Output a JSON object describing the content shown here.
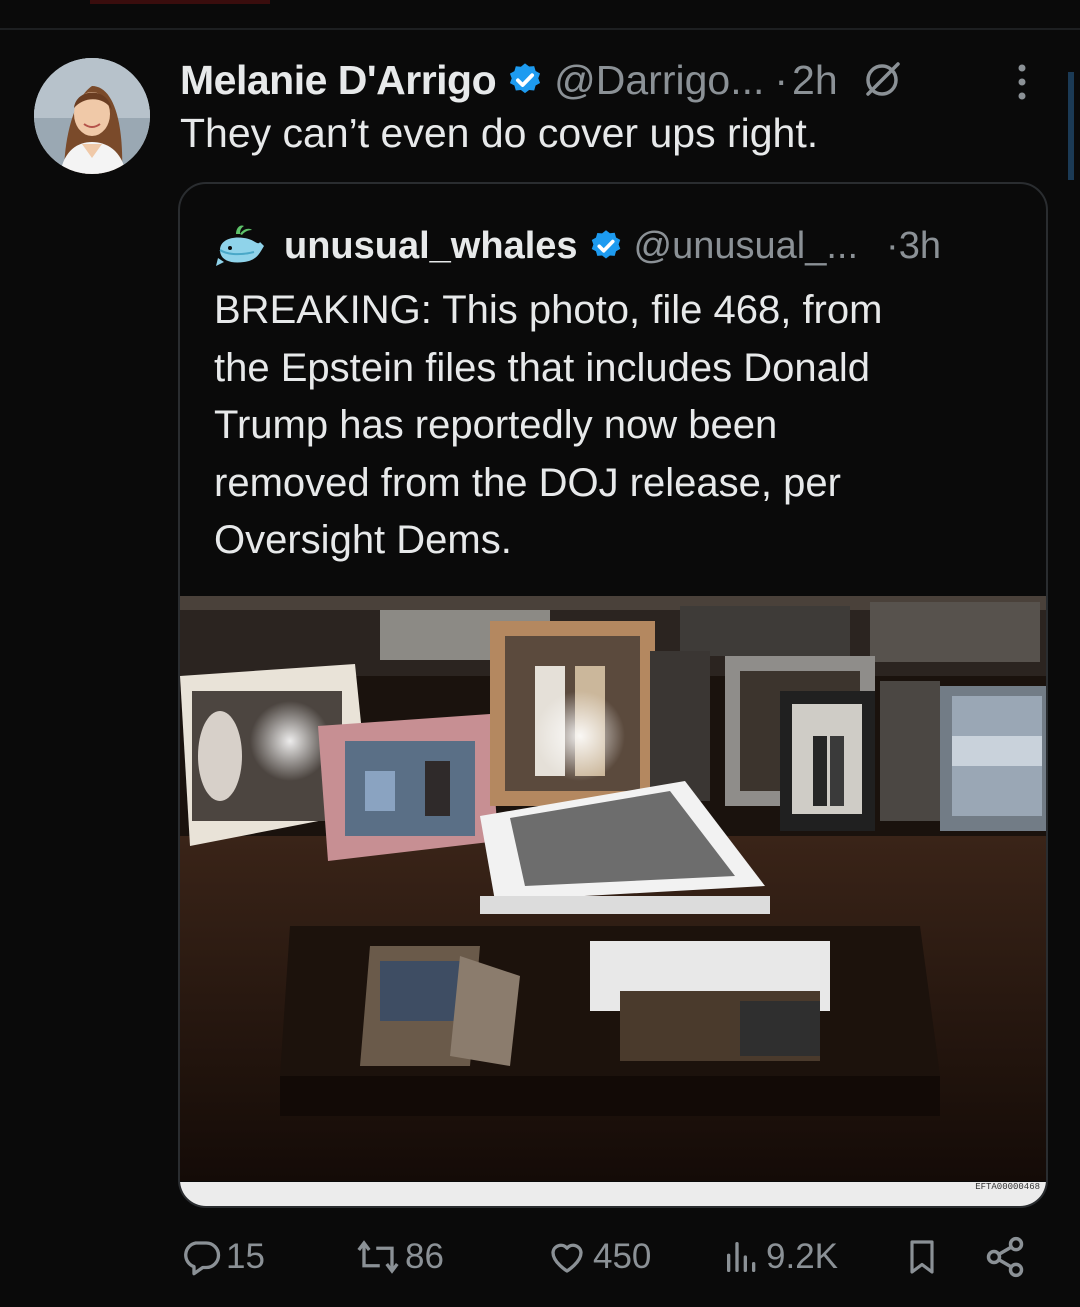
{
  "post": {
    "author_name": "Melanie D'Arrigo",
    "handle": "@Darrigo...",
    "separator": "·",
    "time": "2h",
    "text": "They can’t even do cover ups right."
  },
  "quoted_post": {
    "author_name": "unusual_whales",
    "handle": "@unusual_...",
    "separator": "·",
    "time": "3h",
    "text_lines": [
      "BREAKING: This photo, file 468, from",
      "the Epstein files that includes Donald",
      "Trump has reportedly now been",
      "removed from the DOJ release, per",
      "Oversight Dems."
    ],
    "photo_tag": "EFTA00000468"
  },
  "actions": {
    "replies": "15",
    "reposts": "86",
    "likes": "450",
    "views": "9.2K"
  },
  "icons": [
    "verified-badge-icon",
    "grok-icon",
    "more-options-icon",
    "whale-logo-icon",
    "reply-icon",
    "repost-icon",
    "like-icon",
    "views-icon",
    "bookmark-icon",
    "share-icon"
  ],
  "colors": {
    "background": "#0a0a0a",
    "text": "#e7e9ea",
    "muted": "#8b9196",
    "verified": "#1d9bf0",
    "quote_border": "#2a2d30"
  }
}
